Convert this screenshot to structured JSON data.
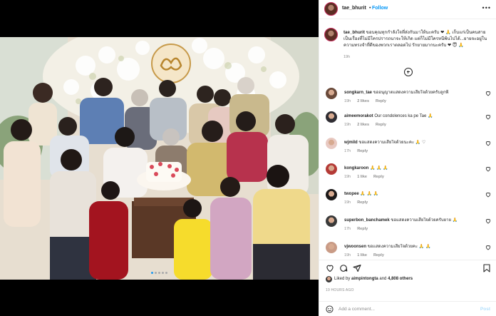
{
  "post": {
    "username": "tae_bhurit",
    "follow_label": "Follow",
    "more_label": "•••",
    "caption_username": "tae_bhurit",
    "caption_text": "ขอบคุณทุกกำลังใจที่ส่งกันมาให้นะครับ ❤ 🙏 เก็บแก่เป็นคนสายเป็นเรื่องที่ไม่มีใครปรารถนาจะให้เกิด แต่ก็ไม่มีใครหนีพ้นไปได้...ยายจะอยู่ในความทรงจำที่ดีของพวกเราตลอดไป รักยายมากนะครับ ❤ 😇 🙏",
    "caption_time": "19h",
    "photo_dots": 5,
    "photo_active_dot": 0
  },
  "comments": [
    {
      "user": "songkarn_tae",
      "text": "ขออนุญาตแสดงความเสียใจด้วยครับลูกพี่",
      "time": "19h",
      "likes": "2 likes",
      "reply": "Reply"
    },
    {
      "user": "aimeemorakot",
      "text": "Our condolences ka pe Tae 🙏",
      "time": "19h",
      "likes": "2 likes",
      "reply": "Reply"
    },
    {
      "user": "wjmild",
      "text": "ขอแสดงความเสียใจด้วยนะคะ 🙏 ♡",
      "time": "17h",
      "likes": "",
      "reply": "Reply"
    },
    {
      "user": "kongkaroon",
      "text": "🙏 🙏 🙏",
      "time": "19h",
      "likes": "1 like",
      "reply": "Reply"
    },
    {
      "user": "twopee",
      "text": "🙏 🙏 🙏",
      "time": "19h",
      "likes": "",
      "reply": "Reply"
    },
    {
      "user": "superbon_banchamek",
      "text": "ขอแสดงความเสียใจด้วยครับยาย 🙏",
      "time": "17h",
      "likes": "",
      "reply": "Reply"
    },
    {
      "user": "vjwoonsen",
      "text": "ขอแสดงความเสียใจด้วยคะ 🙏 🙏",
      "time": "19h",
      "likes": "1 like",
      "reply": "Reply"
    }
  ],
  "actions": {
    "icons": [
      "heart-icon",
      "comment-icon",
      "share-icon",
      "bookmark-icon"
    ]
  },
  "likes": {
    "prefix": "Liked by",
    "user": "aimpintongta",
    "middle": "and",
    "count": "4,808 others"
  },
  "time_ago": "19 HOURS AGO",
  "add_comment": {
    "placeholder": "Add a comment...",
    "post_label": "Post"
  },
  "colors": {
    "follow_blue": "#0095f6",
    "post_disabled": "#b2dffc",
    "muted": "#8e8e8e",
    "active_dot": "#1f9bf0"
  }
}
